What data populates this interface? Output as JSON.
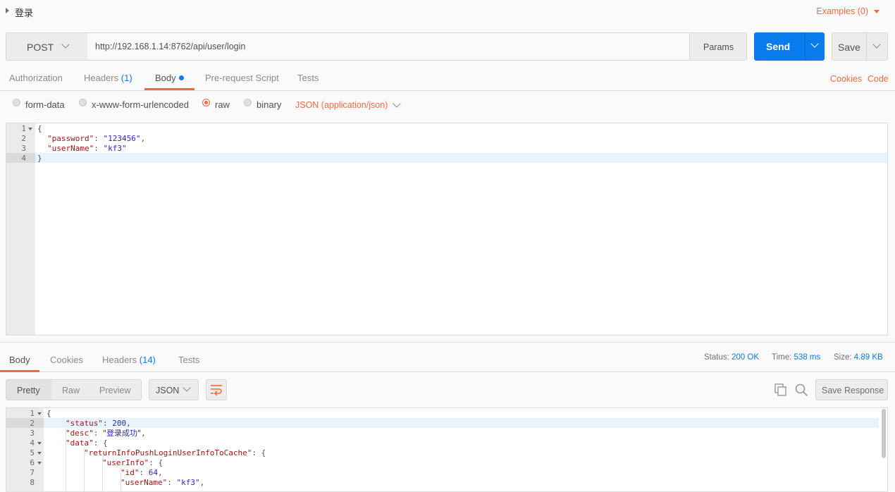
{
  "request": {
    "title": "登录",
    "examples_label": "Examples (0)",
    "method": "POST",
    "url": "http://192.168.1.14:8762/api/user/login",
    "params_label": "Params",
    "send_label": "Send",
    "save_label": "Save"
  },
  "request_tabs": {
    "authorization": "Authorization",
    "headers": "Headers",
    "headers_count": "(1)",
    "body": "Body",
    "prerequest": "Pre-request Script",
    "tests": "Tests",
    "cookies": "Cookies",
    "code": "Code"
  },
  "body_types": {
    "form_data": "form-data",
    "urlencoded": "x-www-form-urlencoded",
    "raw": "raw",
    "binary": "binary",
    "selected": "raw",
    "content_type": "JSON (application/json)"
  },
  "request_body": {
    "lines": [
      {
        "n": "1",
        "open": "{"
      },
      {
        "n": "2",
        "key": "\"password\"",
        "val": "\"123456\"",
        "trail": ","
      },
      {
        "n": "3",
        "key": "\"userName\"",
        "val": "\"kf3\"",
        "trail": ""
      },
      {
        "n": "4",
        "close": "}"
      }
    ]
  },
  "response_tabs": {
    "body": "Body",
    "cookies": "Cookies",
    "headers": "Headers",
    "headers_count": "(14)",
    "tests": "Tests"
  },
  "response_status": {
    "status_label": "Status:",
    "status_value": "200 OK",
    "time_label": "Time:",
    "time_value": "538 ms",
    "size_label": "Size:",
    "size_value": "4.89 KB"
  },
  "response_toolbar": {
    "pretty": "Pretty",
    "raw": "Raw",
    "preview": "Preview",
    "format": "JSON",
    "save_response": "Save Response"
  },
  "response_body": {
    "line_numbers": [
      "1",
      "2",
      "3",
      "4",
      "5",
      "6",
      "7",
      "8"
    ],
    "l1": "{",
    "l2_key": "\"status\"",
    "l2_val": "200",
    "l2_trail": ",",
    "l3_key": "\"desc\"",
    "l3_val": "\"登录成功\"",
    "l3_trail": ",",
    "l4_key": "\"data\"",
    "l4_trail": ": {",
    "l5_key": "\"returnInfoPushLoginUserInfoToCache\"",
    "l5_trail": ": {",
    "l6_key": "\"userInfo\"",
    "l6_trail": ": {",
    "l7_key": "\"id\"",
    "l7_val": "64",
    "l7_trail": ",",
    "l8_key": "\"userName\"",
    "l8_val": "\"kf3\"",
    "l8_trail": ","
  },
  "colors": {
    "accent": "#f26b3a",
    "primary": "#097bed"
  }
}
